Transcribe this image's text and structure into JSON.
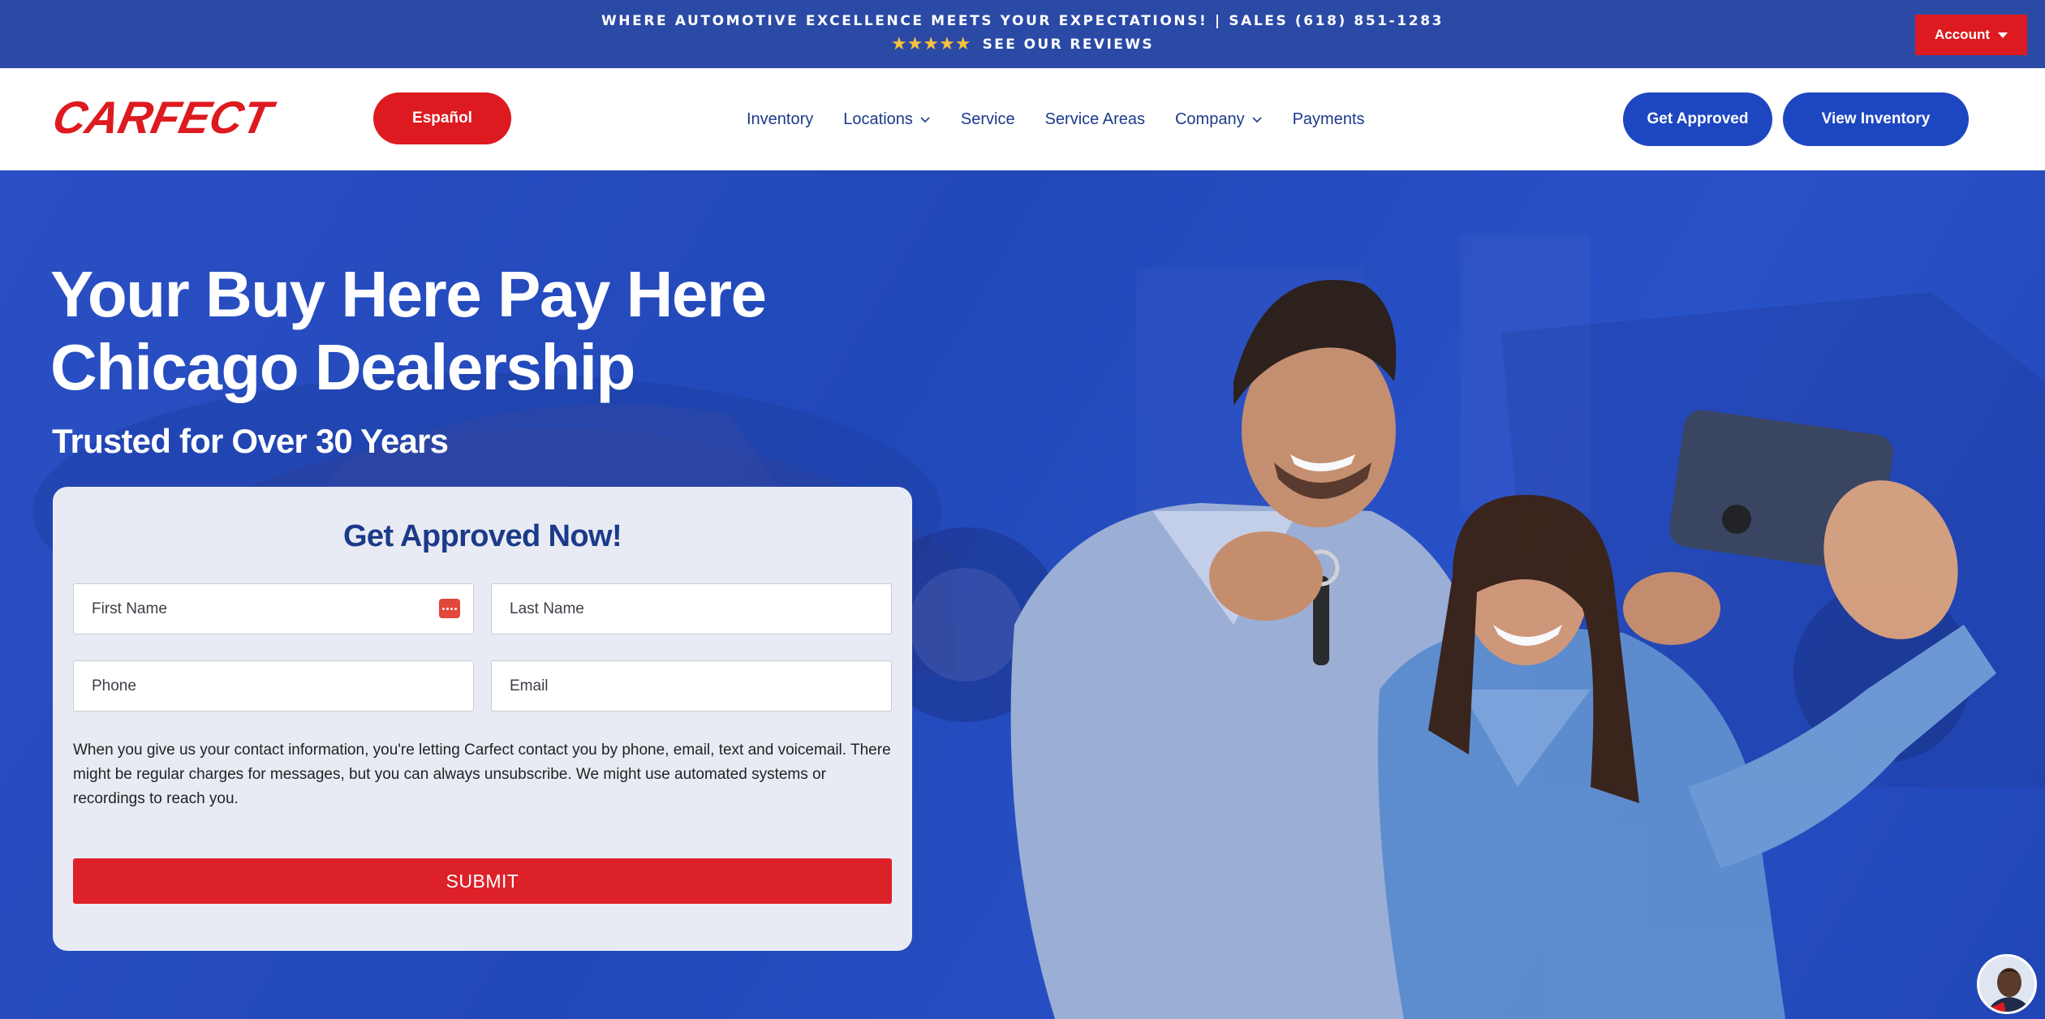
{
  "topbar": {
    "promo": "WHERE AUTOMOTIVE EXCELLENCE MEETS YOUR EXPECTATIONS! | SALES (618) 851-1283",
    "stars": "★★★★★",
    "reviews_link": "SEE OUR REVIEWS",
    "account_label": "Account"
  },
  "header": {
    "logo_text": "CARFECT",
    "espanol_label": "Español",
    "nav": [
      {
        "label": "Inventory"
      },
      {
        "label": "Locations"
      },
      {
        "label": "Service"
      },
      {
        "label": "Service Areas"
      },
      {
        "label": "Company"
      },
      {
        "label": "Payments"
      }
    ],
    "get_approved_label": "Get Approved",
    "view_inventory_label": "View Inventory"
  },
  "hero": {
    "title_line1": "Your Buy Here Pay Here",
    "title_line2": "Chicago Dealership",
    "subtitle": "Trusted for Over 30 Years"
  },
  "form": {
    "title": "Get Approved Now!",
    "first_name_placeholder": "First Name",
    "last_name_placeholder": "Last Name",
    "phone_placeholder": "Phone",
    "email_placeholder": "Email",
    "consent": "When you give us your contact information, you're letting Carfect contact you by phone, email, text and voicemail. There might be regular charges for messages, but you can always unsubscribe. We might use automated systems or recordings to reach you.",
    "submit_label": "SUBMIT"
  },
  "colors": {
    "brand_red": "#dd1a1f",
    "brand_blue": "#1d47c0",
    "topbar_blue": "#2b4aa6",
    "nav_text": "#1c3a8a"
  }
}
